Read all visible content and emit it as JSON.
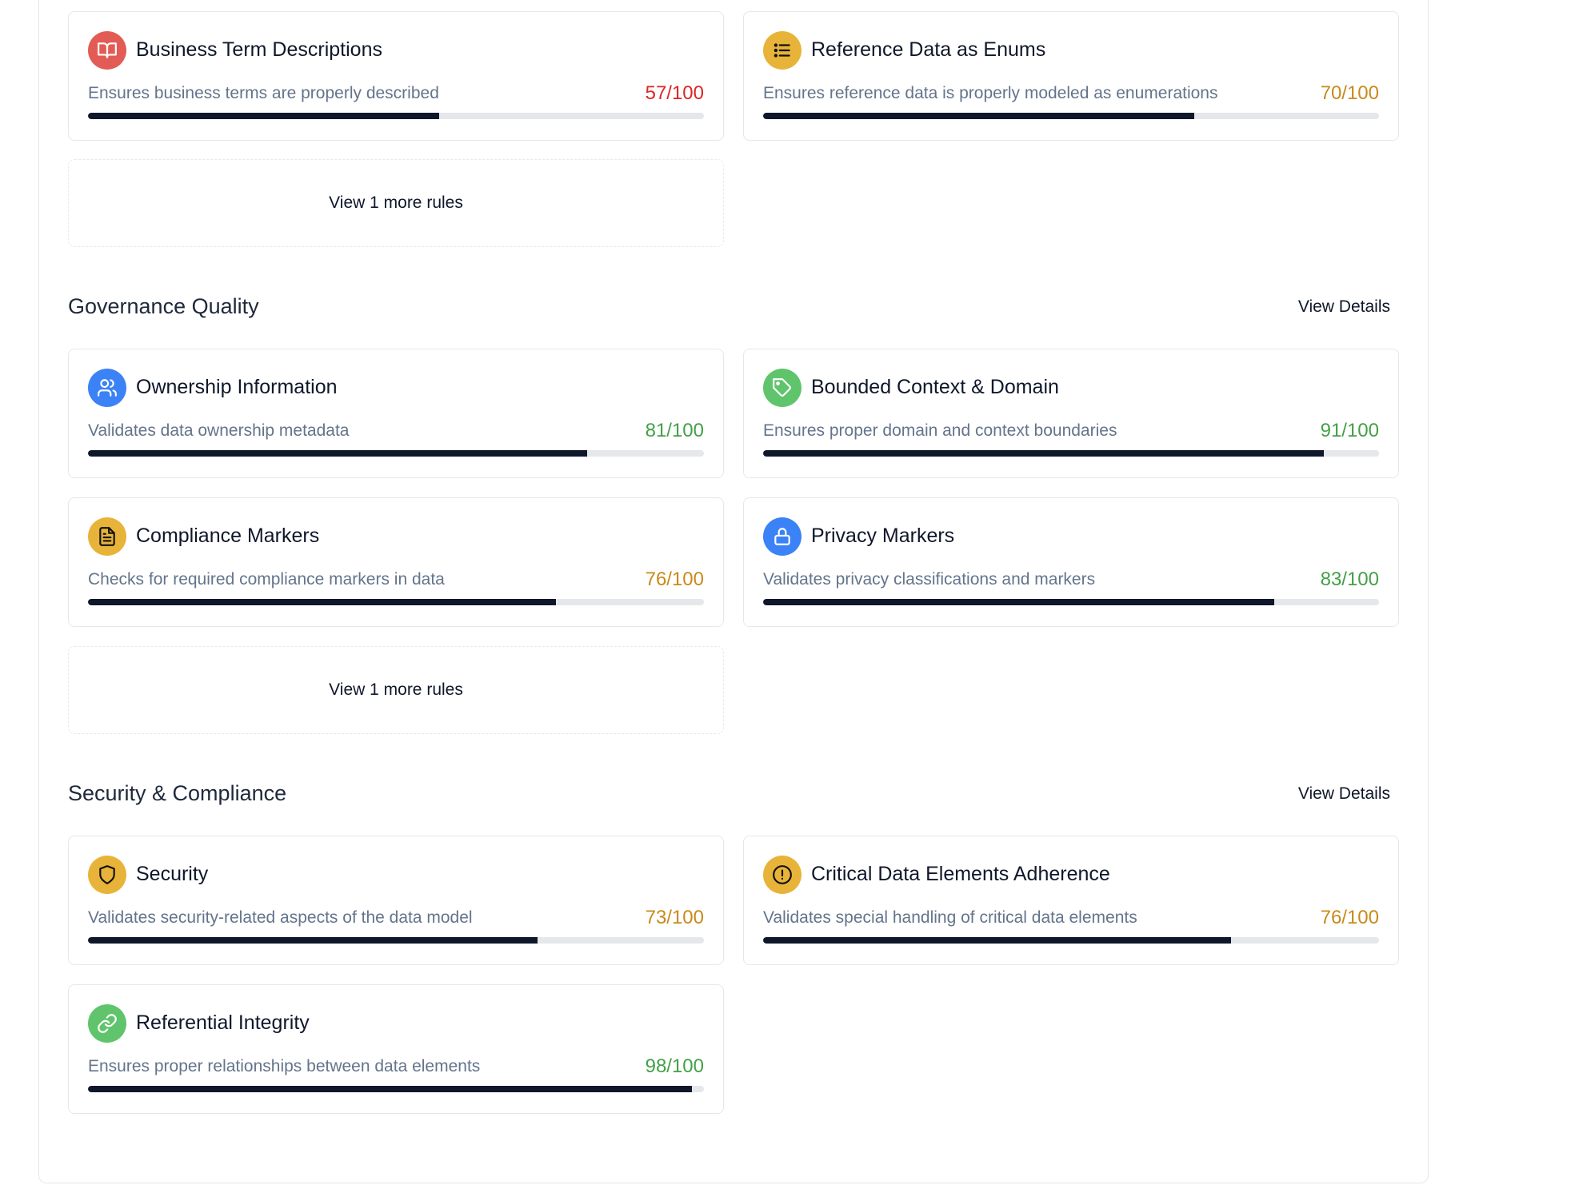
{
  "sections": [
    {
      "title": "",
      "view_details": "",
      "rules": [
        {
          "title": "Business Term Descriptions",
          "desc": "Ensures business terms are properly described",
          "score": "57/100",
          "value": 0.57,
          "icon": "book-open-icon",
          "color": "#e25c55"
        },
        {
          "title": "Reference Data as Enums",
          "desc": "Ensures reference data is properly modeled as enumerations",
          "score": "70/100",
          "value": 0.7,
          "icon": "list-icon",
          "color": "#e8b339"
        }
      ],
      "more": "View 1 more rules"
    },
    {
      "title": "Governance Quality",
      "view_details": "View Details",
      "rules": [
        {
          "title": "Ownership Information",
          "desc": "Validates data ownership metadata",
          "score": "81/100",
          "value": 0.81,
          "icon": "users-icon",
          "color": "#3b82f6"
        },
        {
          "title": "Bounded Context & Domain",
          "desc": "Ensures proper domain and context boundaries",
          "score": "91/100",
          "value": 0.91,
          "icon": "tag-icon",
          "color": "#5fc46b"
        },
        {
          "title": "Compliance Markers",
          "desc": "Checks for required compliance markers in data",
          "score": "76/100",
          "value": 0.76,
          "icon": "document-icon",
          "color": "#e8b339"
        },
        {
          "title": "Privacy Markers",
          "desc": "Validates privacy classifications and markers",
          "score": "83/100",
          "value": 0.83,
          "icon": "lock-icon",
          "color": "#3b82f6"
        }
      ],
      "more": "View 1 more rules"
    },
    {
      "title": "Security & Compliance",
      "view_details": "View Details",
      "rules": [
        {
          "title": "Security",
          "desc": "Validates security-related aspects of the data model",
          "score": "73/100",
          "value": 0.73,
          "icon": "shield-icon",
          "color": "#e8b339"
        },
        {
          "title": "Critical Data Elements Adherence",
          "desc": "Validates special handling of critical data elements",
          "score": "76/100",
          "value": 0.76,
          "icon": "alert-circle-icon",
          "color": "#e8b339"
        },
        {
          "title": "Referential Integrity",
          "desc": "Ensures proper relationships between data elements",
          "score": "98/100",
          "value": 0.98,
          "icon": "link-icon",
          "color": "#5fc46b"
        }
      ]
    }
  ],
  "score_colors": {
    "low": "#dc2626",
    "mid": "#c98a1a",
    "high": "#43a047"
  }
}
